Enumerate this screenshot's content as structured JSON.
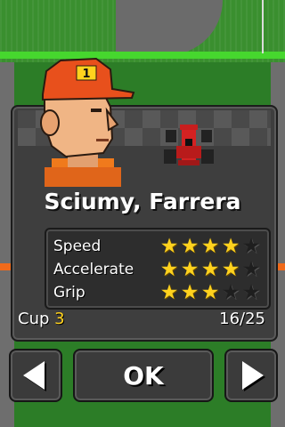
{
  "driver": {
    "name": "Sciumy, Farrera",
    "cap_number": "1"
  },
  "stats": [
    {
      "label": "Speed",
      "stars": 4,
      "max": 5
    },
    {
      "label": "Accelerate",
      "stars": 4,
      "max": 5
    },
    {
      "label": "Grip",
      "stars": 3,
      "max": 5
    }
  ],
  "cup": {
    "label": "Cup",
    "number": "3"
  },
  "progress": "16/25",
  "buttons": {
    "ok_label": "OK",
    "prev_icon": "left-triangle-icon",
    "next_icon": "right-triangle-icon"
  },
  "colors": {
    "star_on": "#ffd21e",
    "star_off": "#1e1e1e",
    "cup_number": "#ffd21e"
  }
}
